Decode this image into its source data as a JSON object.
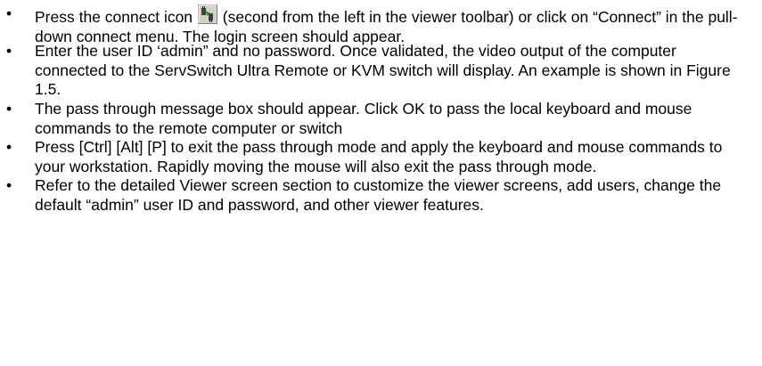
{
  "bullets": [
    {
      "before_icon": "Press the connect icon ",
      "icon": "connect-plug-icon",
      "after_icon": " (second from the left in the viewer toolbar) or click on “Connect” in the pull-down connect menu.  The login screen should appear."
    },
    {
      "text": "Enter the user ID ‘admin” and no password.  Once validated, the video output of the computer connected to the ServSwitch Ultra Remote or KVM switch will display.  An example is shown in Figure 1.5."
    },
    {
      "text": "The pass through message box should appear.  Click OK to pass the local keyboard and mouse commands to the remote computer or switch"
    },
    {
      "text": "Press [Ctrl] [Alt] [P] to exit the pass through mode and apply the keyboard and mouse commands to your workstation.  Rapidly moving the mouse will also exit the pass through mode."
    },
    {
      "text": "Refer to the detailed Viewer screen section to customize the viewer screens, add users, change the default “admin” user ID and password, and other viewer features."
    }
  ],
  "bullet_glyph": "•"
}
